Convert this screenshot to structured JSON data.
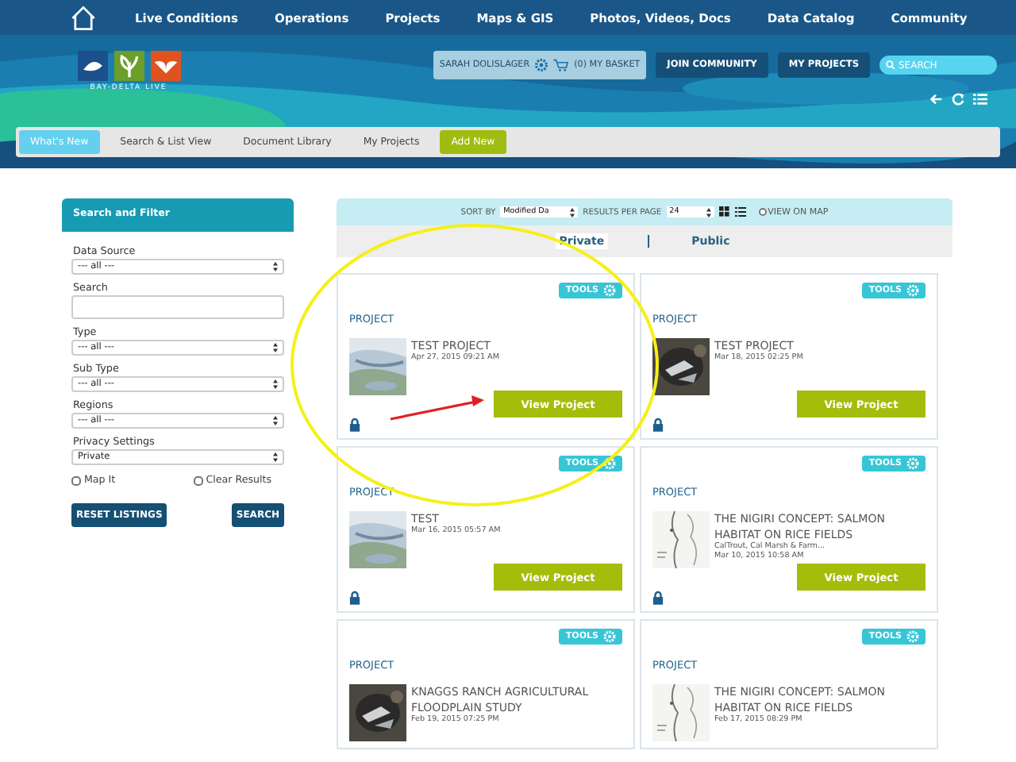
{
  "nav": {
    "items": [
      "Live Conditions",
      "Operations",
      "Projects",
      "Maps & GIS",
      "Photos, Videos, Docs",
      "Data Catalog",
      "Community"
    ]
  },
  "header": {
    "logo_text": "BAY-DELTA LIVE",
    "user": "SARAH DOLISLAGER",
    "basket": "(0) MY BASKET",
    "buttons": [
      "JOIN COMMUNITY",
      "MY PROJECTS"
    ],
    "search_placeholder": "SEARCH"
  },
  "tabs": [
    {
      "label": "What's New",
      "selected": true
    },
    {
      "label": "Search & List View",
      "selected": false
    },
    {
      "label": "Document Library",
      "selected": false
    },
    {
      "label": "My Projects",
      "selected": false
    }
  ],
  "add_button": "Add New",
  "sidebar": {
    "title": "Search and Filter",
    "fields": [
      {
        "kind": "select",
        "label": "Data Source",
        "value": "--- all ---"
      },
      {
        "kind": "text",
        "label": "Search"
      },
      {
        "kind": "select",
        "label": "Type",
        "value": "--- all ---"
      },
      {
        "kind": "select",
        "label": "Sub Type",
        "value": "--- all ---"
      },
      {
        "kind": "select",
        "label": "Regions",
        "value": "--- all ---"
      },
      {
        "kind": "select",
        "label": "Privacy Settings",
        "value": "Private"
      }
    ],
    "checkboxes": [
      {
        "label": "Map It",
        "checked": false
      },
      {
        "label": "Clear Results",
        "checked": false
      }
    ],
    "buttons": [
      "RESET LISTINGS",
      "SEARCH"
    ]
  },
  "toolbar": {
    "sort_label": "SORT BY",
    "sort_value": "Modified Da",
    "per_page_label": "RESULTS PER PAGE",
    "per_page_value": "24",
    "view_on_map": {
      "label": "VIEW ON MAP",
      "checked": false
    }
  },
  "visibility": [
    {
      "label": "Private",
      "selected": true
    },
    {
      "label": "Public",
      "selected": false
    }
  ],
  "cards": [
    [
      {
        "type": "PROJECT",
        "tools": "TOOLS",
        "title": "TEST PROJECT",
        "date": "Apr 27, 2015 09:21 AM",
        "button": "View Project",
        "locked": true
      },
      {
        "type": "PROJECT",
        "tools": "TOOLS",
        "title": "TEST",
        "date": "Mar 16, 2015 05:57 AM",
        "button": "View Project",
        "locked": true
      },
      {
        "type": "PROJECT",
        "tools": "TOOLS",
        "title": "KNAGGS RANCH AGRICULTURAL FLOODPLAIN STUDY",
        "date": "Feb 19, 2015 07:25 PM"
      }
    ],
    [
      {
        "type": "PROJECT",
        "tools": "TOOLS",
        "title": "TEST PROJECT",
        "date": "Mar 18, 2015 02:25 PM",
        "button": "View Project",
        "locked": true
      },
      {
        "type": "PROJECT",
        "tools": "TOOLS",
        "title": "THE NIGIRI CONCEPT: SALMON HABITAT ON RICE FIELDS",
        "subtitle": "CalTrout, Cal Marsh & Farm...",
        "date": "Mar 10, 2015 10:58 AM",
        "button": "View Project",
        "locked": true
      },
      {
        "type": "PROJECT",
        "tools": "TOOLS",
        "title": "THE NIGIRI CONCEPT: SALMON HABITAT ON RICE FIELDS",
        "date": "Feb 17, 2015 08:29 PM"
      }
    ]
  ]
}
